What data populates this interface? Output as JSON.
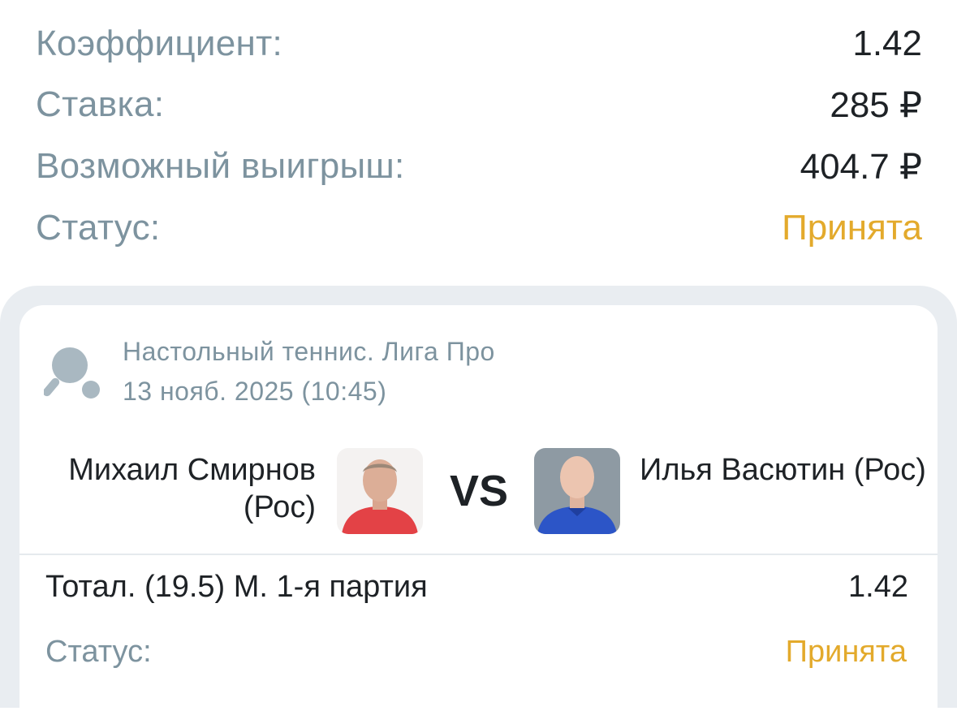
{
  "summary": {
    "rows": [
      {
        "label": "Коэффициент:",
        "value": "1.42"
      },
      {
        "label": "Ставка:",
        "value": "285 ₽"
      },
      {
        "label": "Возможный выигрыш:",
        "value": "404.7 ₽"
      },
      {
        "label": "Статус:",
        "value": "Принята"
      }
    ]
  },
  "event": {
    "sport_icon": "table-tennis-icon",
    "league": "Настольный теннис. Лига Про",
    "datetime": "13 нояб. 2025 (10:45)",
    "player1": {
      "name": "Михаил Смирнов (Рос)"
    },
    "player2": {
      "name": "Илья Васютин (Рос)"
    },
    "vs": "VS"
  },
  "bet": {
    "market": "Тотал. (19.5) М. 1-я партия",
    "odds": "1.42",
    "status_label": "Статус:",
    "status_value": "Принята"
  },
  "colors": {
    "label_gray": "#7d939f",
    "accent_status": "#e3aa2c",
    "text_dark": "#1e2226",
    "outer_bg": "#e9edf1"
  }
}
